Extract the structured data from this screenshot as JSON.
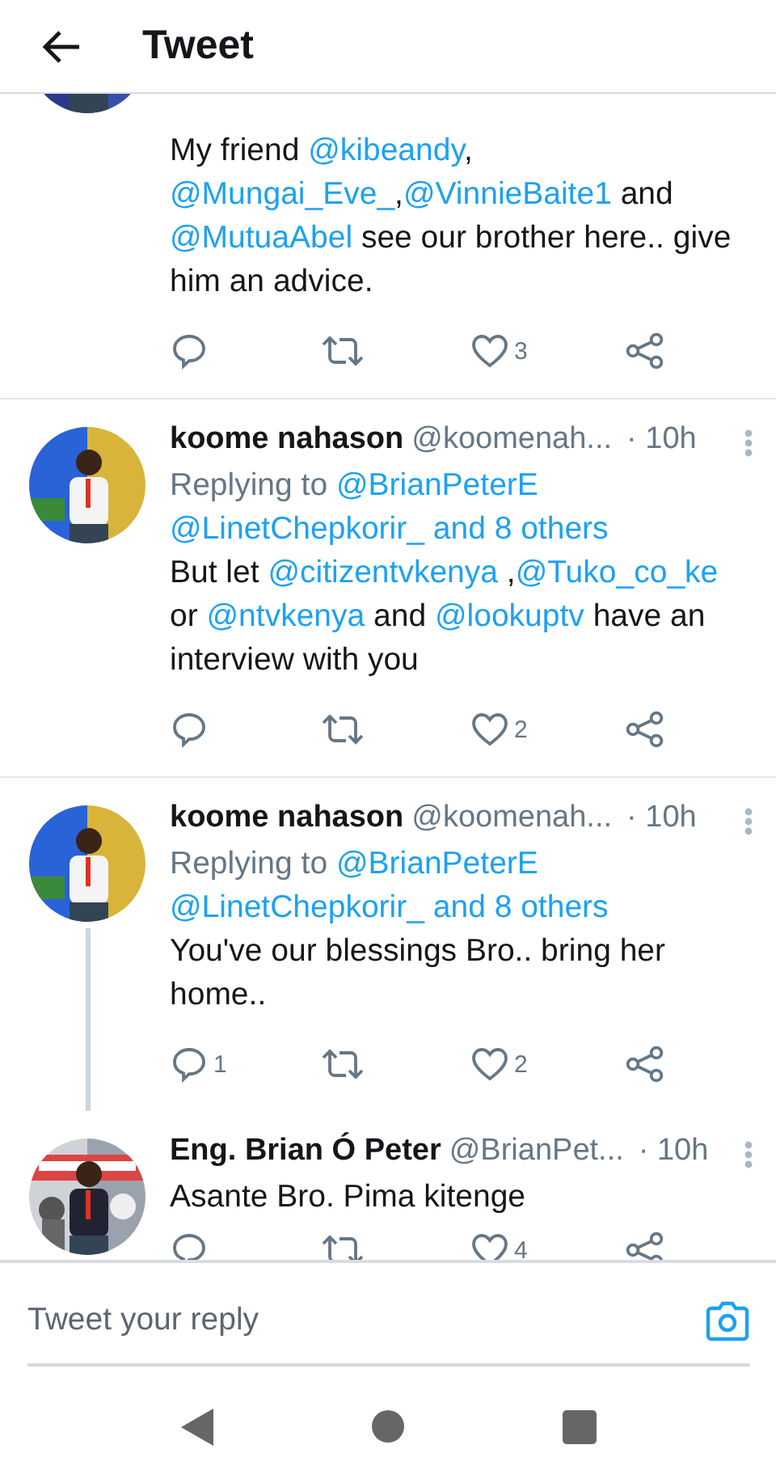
{
  "header": {
    "title": "Tweet"
  },
  "tweets": [
    {
      "partial": true,
      "thread_continues": false,
      "text": [
        {
          "kind": "plain",
          "text": "My friend "
        },
        {
          "kind": "mention",
          "text": "@kibeandy"
        },
        {
          "kind": "plain",
          "text": ", "
        },
        {
          "kind": "mention",
          "text": "@Mungai_Eve_"
        },
        {
          "kind": "plain",
          "text": ","
        },
        {
          "kind": "mention",
          "text": "@VinnieBaite1"
        },
        {
          "kind": "plain",
          "text": " and "
        },
        {
          "kind": "mention",
          "text": "@MutuaAbel"
        },
        {
          "kind": "plain",
          "text": " see our brother here.. give him an advice."
        }
      ],
      "actions": {
        "likes": "3"
      }
    },
    {
      "partial": false,
      "name": "koome nahason",
      "handle": "@koomenah...",
      "time": "· 10h",
      "thread_continues": false,
      "replying": [
        {
          "kind": "plain",
          "text": "Replying to "
        },
        {
          "kind": "mention",
          "text": "@BrianPeterE"
        },
        {
          "kind": "mention",
          "text": "@LinetChepkorir_ and 8 others"
        }
      ],
      "text": [
        {
          "kind": "plain",
          "text": "But let "
        },
        {
          "kind": "mention",
          "text": "@citizentvkenya"
        },
        {
          "kind": "plain",
          "text": " ,"
        },
        {
          "kind": "mention",
          "text": "@Tuko_co_ke"
        },
        {
          "kind": "plain",
          "text": " or "
        },
        {
          "kind": "mention",
          "text": "@ntvkenya"
        },
        {
          "kind": "plain",
          "text": " and "
        },
        {
          "kind": "mention",
          "text": "@lookuptv"
        },
        {
          "kind": "plain",
          "text": " have an interview with you"
        }
      ],
      "actions": {
        "likes": "2"
      }
    },
    {
      "partial": false,
      "name": "koome nahason",
      "handle": "@koomenah...",
      "time": "· 10h",
      "thread_continues": true,
      "replying": [
        {
          "kind": "plain",
          "text": "Replying to "
        },
        {
          "kind": "mention",
          "text": "@BrianPeterE"
        },
        {
          "kind": "mention",
          "text": "@LinetChepkorir_ and 8 others"
        }
      ],
      "text": [
        {
          "kind": "plain",
          "text": "You've our blessings Bro.. bring her home.."
        }
      ],
      "actions": {
        "replies": "1",
        "likes": "2"
      }
    },
    {
      "partial": false,
      "name": "Eng. Brian Ó Peter",
      "handle": "@BrianPet...",
      "time": "· 10h",
      "thread_continues": false,
      "text": [
        {
          "kind": "plain",
          "text": "Asante Bro. Pima kitenge"
        }
      ],
      "actions": {
        "likes": "4"
      }
    }
  ],
  "reply_bar": {
    "placeholder": "Tweet your reply"
  }
}
